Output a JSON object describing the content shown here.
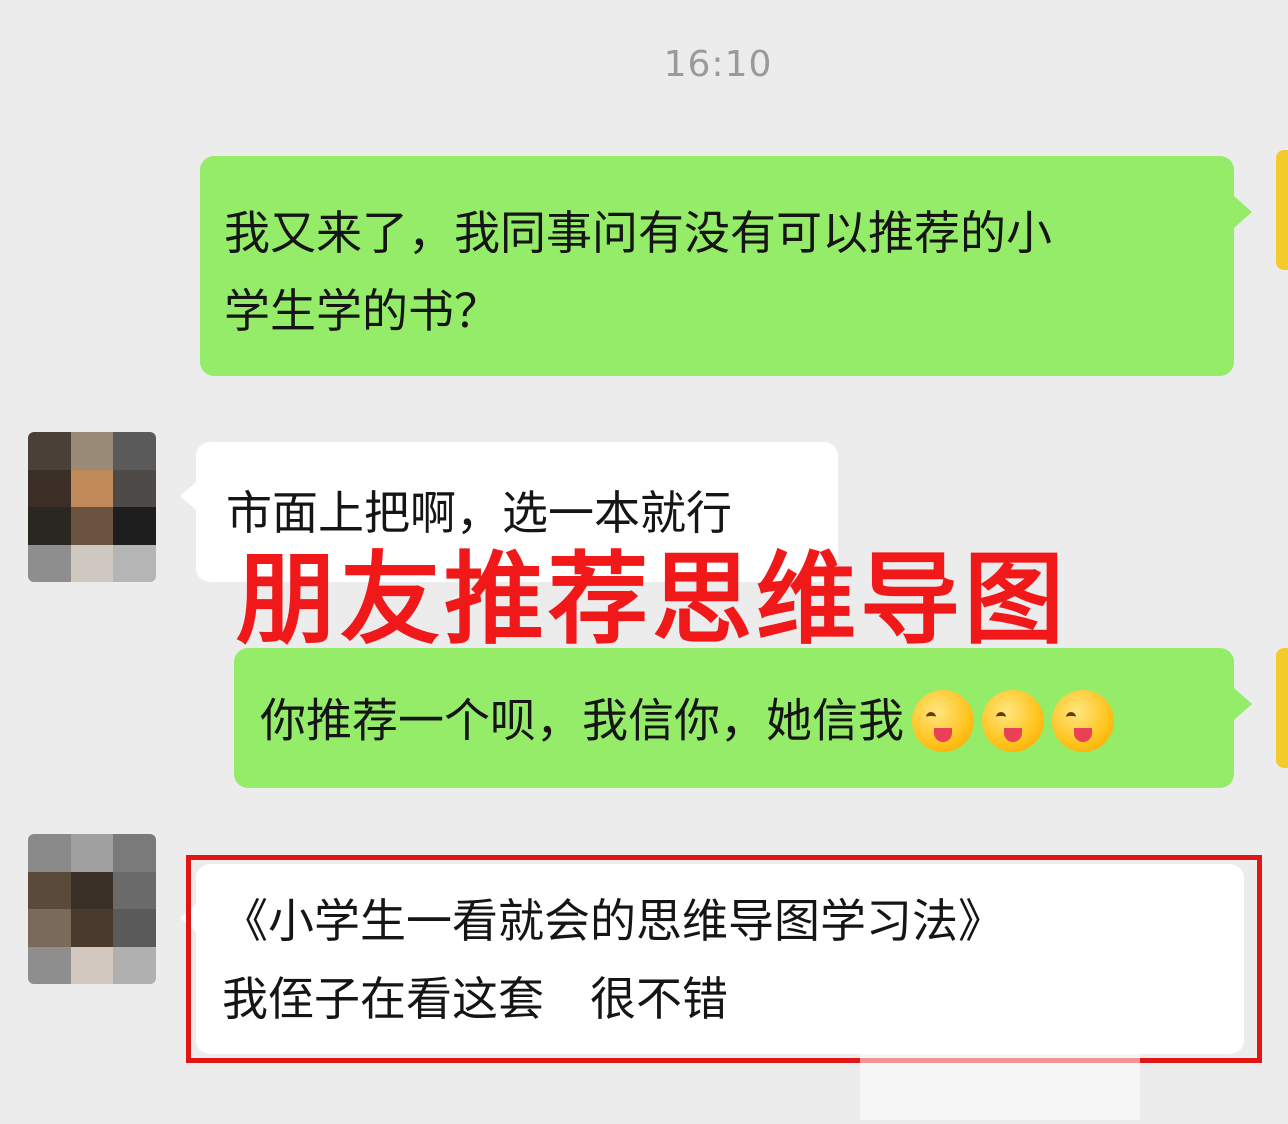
{
  "chat": {
    "timestamp": "16:10",
    "messages": [
      {
        "direction": "out",
        "lines": [
          "我又来了，我同事问有没有可以推荐的小",
          "学生学的书？"
        ]
      },
      {
        "direction": "in",
        "lines": [
          "市面上把啊，选一本就行"
        ]
      },
      {
        "direction": "out",
        "lines": [
          "你推荐一个呗，我信你，她信我"
        ],
        "emoji_count": 3,
        "emoji_icon": "winking-tongue-emoji-icon"
      },
      {
        "direction": "in",
        "lines": [
          "《小学生一看就会的思维导图学习法》",
          "我侄子在看这套　很不错"
        ]
      }
    ]
  },
  "overlay": {
    "caption": "朋友推荐思维导图",
    "caption_color": "#f01818",
    "highlight_box_color": "#e01515"
  },
  "colors": {
    "outgoing_bubble": "#95ec69",
    "incoming_bubble": "#ffffff",
    "background": "#ececec"
  }
}
